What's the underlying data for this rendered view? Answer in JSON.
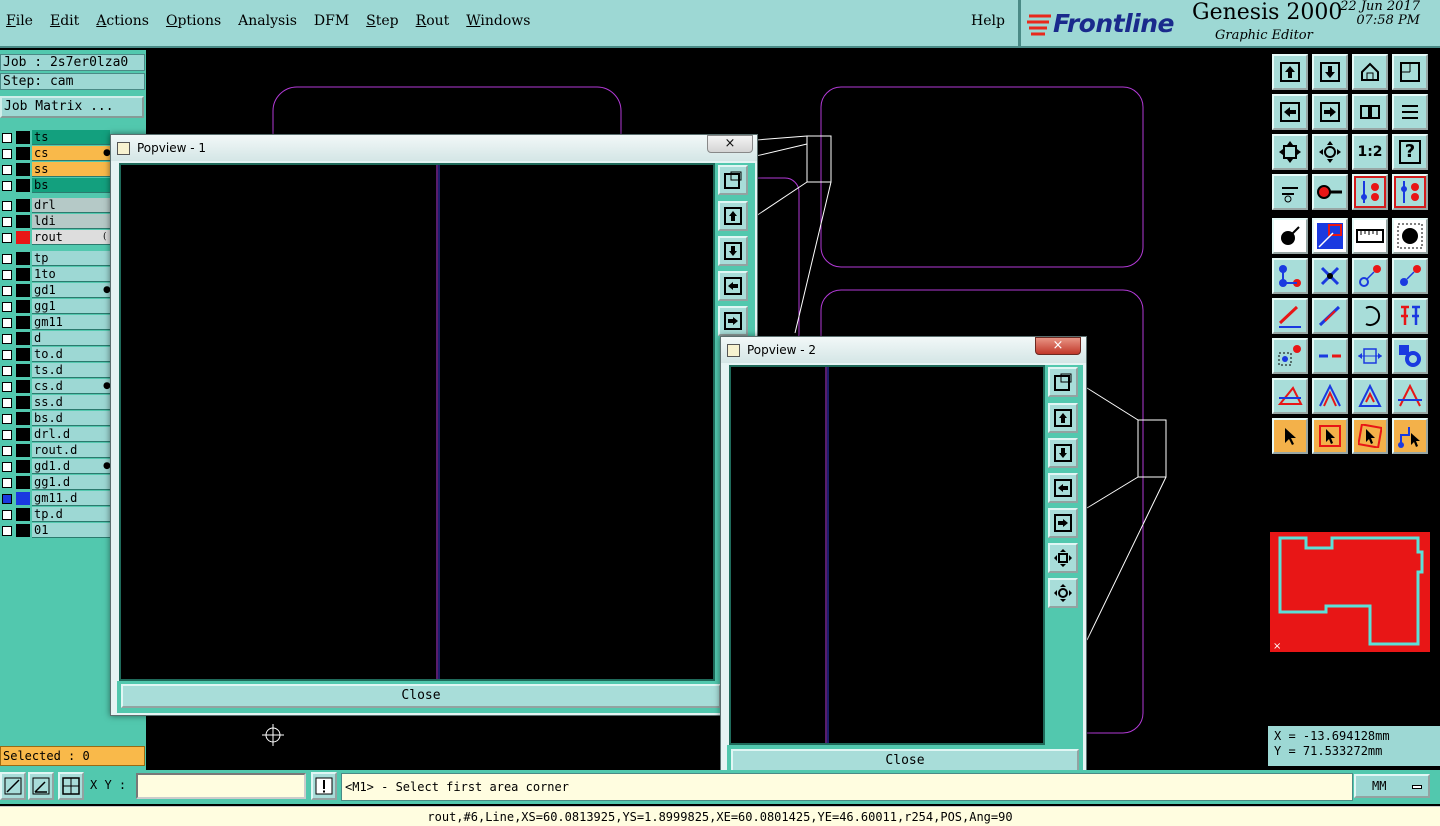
{
  "menu": {
    "items": [
      {
        "label": "File",
        "u": "F",
        "rest": "ile"
      },
      {
        "label": "Edit",
        "u": "E",
        "rest": "dit"
      },
      {
        "label": "Actions",
        "u": "A",
        "rest": "ctions"
      },
      {
        "label": "Options",
        "u": "O",
        "rest": "ptions"
      },
      {
        "label": "Analysis",
        "u": "",
        "rest": "Analysis"
      },
      {
        "label": "DFM",
        "u": "",
        "rest": "DFM"
      },
      {
        "label": "Step",
        "u": "S",
        "rest": "tep"
      },
      {
        "label": "Rout",
        "u": "R",
        "rest": "out"
      },
      {
        "label": "Windows",
        "u": "W",
        "rest": "indows"
      }
    ],
    "help": "Help"
  },
  "brand": {
    "logo": "Frontline",
    "product": "Genesis 2000",
    "subtitle": "Graphic Editor",
    "date": "22 Jun 2017",
    "time": "07:58 PM"
  },
  "job": {
    "job_line": "Job : 2s7er0lza0",
    "step_line": "Step: cam",
    "matrix_button": "Job Matrix ..."
  },
  "layers": [
    {
      "name": "ts",
      "color": "#13a07e",
      "swatch": "#000",
      "mark": ""
    },
    {
      "name": "cs",
      "color": "#f9b94a",
      "swatch": "#000",
      "mark": "●"
    },
    {
      "name": "ss",
      "color": "#f9b94a",
      "swatch": "#000",
      "mark": ""
    },
    {
      "name": "bs",
      "color": "#13a07e",
      "swatch": "#000",
      "mark": ""
    },
    {
      "name": "drl",
      "color": "#b5c9c7",
      "swatch": "#000",
      "mark": ""
    },
    {
      "name": "ldi",
      "color": "#b5c9c7",
      "swatch": "#000",
      "mark": ""
    },
    {
      "name": "rout",
      "color": "#dddddd",
      "swatch": "#e81616",
      "mark": "("
    },
    {
      "name": "tp",
      "color": "#9dd8d4",
      "swatch": "#000",
      "mark": ""
    },
    {
      "name": "1to",
      "color": "#9dd8d4",
      "swatch": "#000",
      "mark": ""
    },
    {
      "name": "gd1",
      "color": "#9dd8d4",
      "swatch": "#000",
      "mark": "●"
    },
    {
      "name": "gg1",
      "color": "#9dd8d4",
      "swatch": "#000",
      "mark": ""
    },
    {
      "name": "gm11",
      "color": "#9dd8d4",
      "swatch": "#000",
      "mark": ""
    },
    {
      "name": "d",
      "color": "#9dd8d4",
      "swatch": "#000",
      "mark": ""
    },
    {
      "name": "to.d",
      "color": "#9dd8d4",
      "swatch": "#000",
      "mark": ""
    },
    {
      "name": "ts.d",
      "color": "#9dd8d4",
      "swatch": "#000",
      "mark": ""
    },
    {
      "name": "cs.d",
      "color": "#9dd8d4",
      "swatch": "#000",
      "mark": "●"
    },
    {
      "name": "ss.d",
      "color": "#9dd8d4",
      "swatch": "#000",
      "mark": ""
    },
    {
      "name": "bs.d",
      "color": "#9dd8d4",
      "swatch": "#000",
      "mark": ""
    },
    {
      "name": "drl.d",
      "color": "#9dd8d4",
      "swatch": "#000",
      "mark": ""
    },
    {
      "name": "rout.d",
      "color": "#9dd8d4",
      "swatch": "#000",
      "mark": ""
    },
    {
      "name": "gd1.d",
      "color": "#9dd8d4",
      "swatch": "#000",
      "mark": "●"
    },
    {
      "name": "gg1.d",
      "color": "#9dd8d4",
      "swatch": "#000",
      "mark": ""
    },
    {
      "name": "gm11.d",
      "color": "#9dd8d4",
      "swatch": "#1a3ae0",
      "mark": ""
    },
    {
      "name": "tp.d",
      "color": "#9dd8d4",
      "swatch": "#000",
      "mark": ""
    },
    {
      "name": "01",
      "color": "#9dd8d4",
      "swatch": "#000",
      "mark": ""
    }
  ],
  "selected": "Selected : 0",
  "popview1": {
    "title": "Popview - 1",
    "close": "Close",
    "x": "×"
  },
  "popview2": {
    "title": "Popview - 2",
    "close": "Close",
    "x": "×"
  },
  "coords": {
    "x": "X = -13.694128mm",
    "y": "Y = 71.533272mm"
  },
  "units": "MM",
  "bottom": {
    "xy_label": "X Y :",
    "xy_value": "",
    "prompt": "<M1> - Select first area corner",
    "status": "rout,#6,Line,XS=60.0813925,YS=1.8999825,XE=60.0801425,YE=46.60011,r254,POS,Ang=90"
  },
  "toolbar": {
    "one_to_one": "1:2",
    "help_glyph": "?"
  }
}
